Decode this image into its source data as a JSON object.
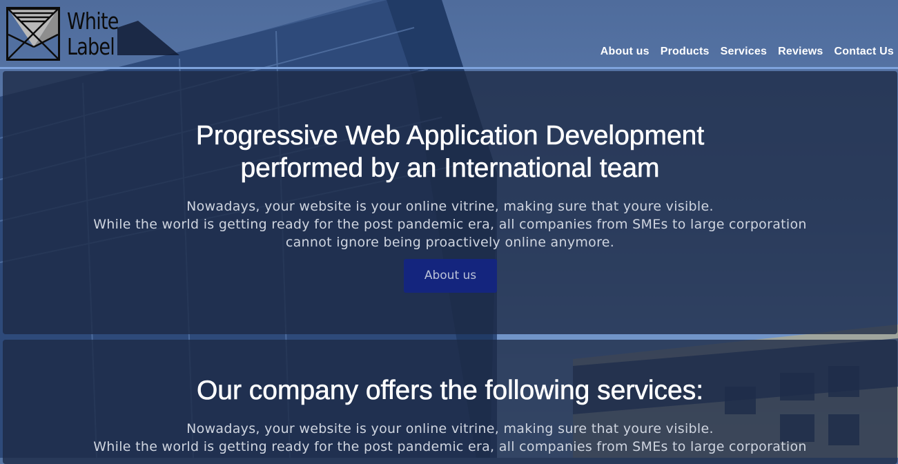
{
  "brand": {
    "line1": "White",
    "line2": "Label"
  },
  "nav": [
    {
      "label": "About us"
    },
    {
      "label": "Products"
    },
    {
      "label": "Services"
    },
    {
      "label": "Reviews"
    },
    {
      "label": "Contact Us"
    }
  ],
  "hero": {
    "title_line1": "Progressive Web Application Development",
    "title_line2": "performed by an International team",
    "text_line1": "Nowadays, your website is your online vitrine, making sure that youre visible.",
    "text_line2": "While the world is getting ready for the post pandemic era, all companies from SMEs to large corporation",
    "text_line3": "cannot ignore being proactively online anymore.",
    "button_label": "About us"
  },
  "services": {
    "title": "Our company offers the following services:",
    "text_line1": "Nowadays, your website is your online vitrine, making sure that youre visible.",
    "text_line2": "While the world is getting ready for the post pandemic era, all companies from SMEs to large corporation"
  },
  "colors": {
    "panel": "#1c2944",
    "button": "#14257e",
    "accent_line": "#7ea3dc"
  }
}
